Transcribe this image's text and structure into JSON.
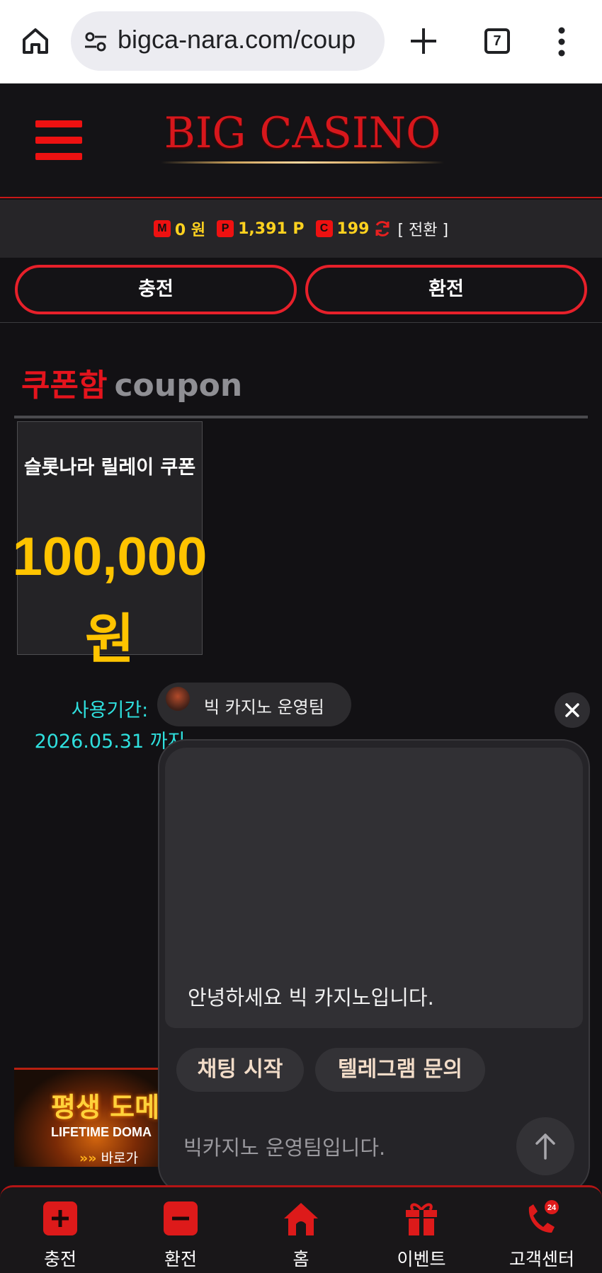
{
  "browser": {
    "url": "bigca-nara.com/coup",
    "tab_count": "7"
  },
  "header": {
    "logo": "BIG CASINO"
  },
  "balance": {
    "money_badge": "M",
    "money_value": "0 원",
    "point_badge": "P",
    "point_value": "1,391 P",
    "coin_badge": "C",
    "coin_value": "199",
    "switch_label": "[ 전환 ]"
  },
  "actions": {
    "charge_label": "충전",
    "exchange_label": "환전"
  },
  "coupon_box": {
    "title_kr": "쿠폰함",
    "title_en": "coupon",
    "items": [
      {
        "name": "슬롯나라 릴레이 쿠폰",
        "amount": "100,000",
        "unit": "원",
        "expire": "사용기간: 2026.05.31 까지"
      }
    ]
  },
  "banner": {
    "title_kr": "평생 도메",
    "title_en": "LIFETIME DOMA",
    "arrows": "»»",
    "cta": "바로가"
  },
  "chat": {
    "sender_name": "빅 카지노 운영팀",
    "message": "안녕하세요 빅 카지노입니다.",
    "chip_start": "채팅 시작",
    "chip_telegram": "텔레그램 문의",
    "input_placeholder": "빅카지노 운영팀입니다."
  },
  "bottom_nav": [
    {
      "label": "충전",
      "icon": "plus-icon"
    },
    {
      "label": "환전",
      "icon": "minus-icon"
    },
    {
      "label": "홈",
      "icon": "home-icon"
    },
    {
      "label": "이벤트",
      "icon": "gift-icon"
    },
    {
      "label": "고객센터",
      "icon": "phone-24-icon",
      "badge": "24"
    }
  ],
  "colors": {
    "accent_red": "#e7202a",
    "gold": "#ffc400",
    "cyan": "#2fe0de",
    "background": "#121114"
  }
}
